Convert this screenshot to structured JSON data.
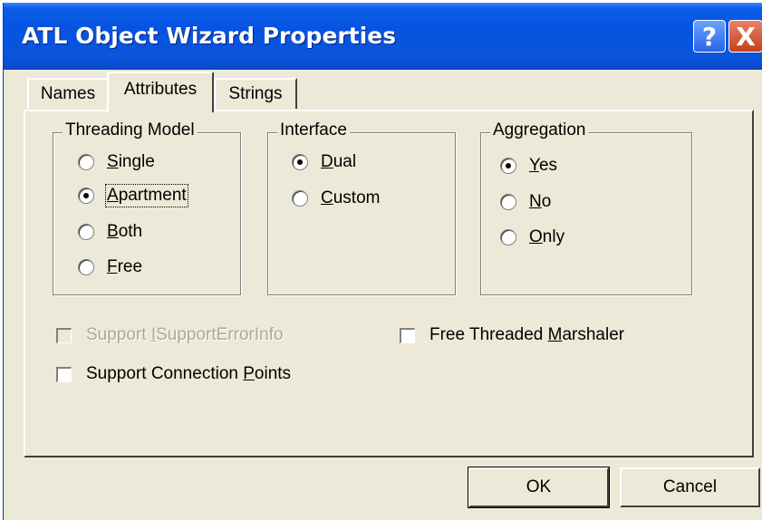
{
  "window": {
    "title": "ATL Object Wizard Properties",
    "help_glyph": "?",
    "close_glyph": "X"
  },
  "tabs": [
    {
      "label": "Names",
      "active": false
    },
    {
      "label": "Attributes",
      "active": true
    },
    {
      "label": "Strings",
      "active": false
    }
  ],
  "threading_model": {
    "label": "Threading Model",
    "options": [
      {
        "pre": "",
        "key": "S",
        "post": "ingle",
        "checked": false
      },
      {
        "pre": "",
        "key": "A",
        "post": "partment",
        "checked": true
      },
      {
        "pre": "",
        "key": "B",
        "post": "oth",
        "checked": false
      },
      {
        "pre": "",
        "key": "F",
        "post": "ree",
        "checked": false
      }
    ]
  },
  "interface": {
    "label": "Interface",
    "options": [
      {
        "pre": "",
        "key": "D",
        "post": "ual",
        "checked": true
      },
      {
        "pre": "",
        "key": "C",
        "post": "ustom",
        "checked": false
      }
    ]
  },
  "aggregation": {
    "label": "Aggregation",
    "options": [
      {
        "pre": "",
        "key": "Y",
        "post": "es",
        "checked": true
      },
      {
        "pre": "",
        "key": "N",
        "post": "o",
        "checked": false
      },
      {
        "pre": "",
        "key": "O",
        "post": "nly",
        "checked": false
      }
    ]
  },
  "checkboxes": {
    "support_error_info": {
      "pre": "Support ",
      "key": "I",
      "post": "SupportErrorInfo",
      "checked": false,
      "enabled": false
    },
    "free_threaded": {
      "pre": "Free Threaded ",
      "key": "M",
      "post": "arshaler",
      "checked": false,
      "enabled": true
    },
    "connection_points": {
      "pre": "Support Connection ",
      "key": "P",
      "post": "oints",
      "checked": false,
      "enabled": true
    }
  },
  "buttons": {
    "ok": "OK",
    "cancel": "Cancel"
  },
  "colors": {
    "title_bar": "#0653e0",
    "dialog_bg": "#ece9d8",
    "disabled_text": "#aca899"
  }
}
